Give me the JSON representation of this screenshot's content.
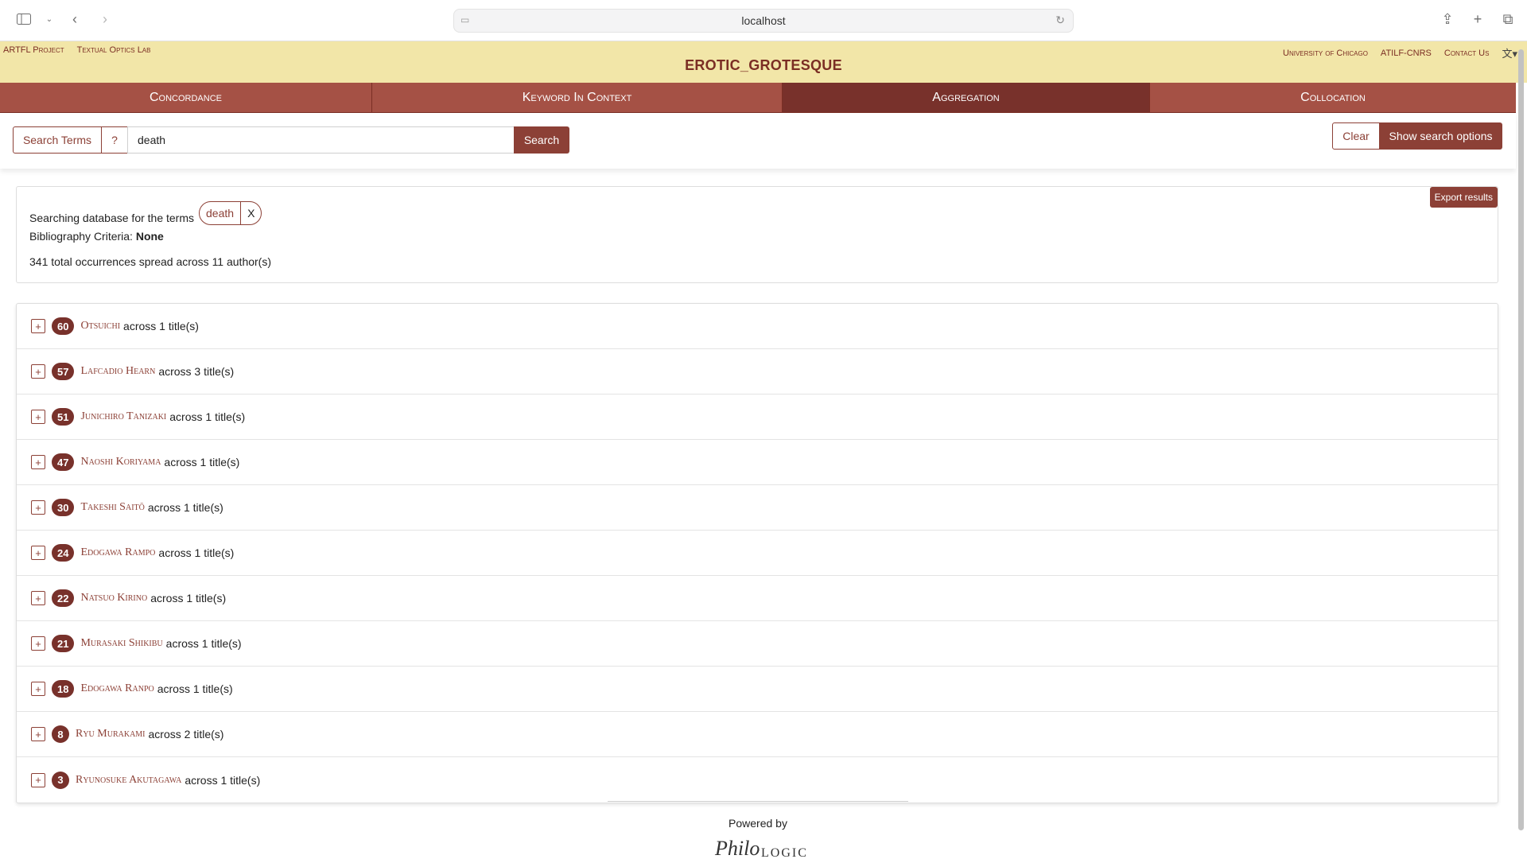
{
  "browser": {
    "url": "localhost"
  },
  "header": {
    "left_links": [
      "ARTFL Project",
      "Textual Optics Lab"
    ],
    "right_links": [
      "University of Chicago",
      "ATILF-CNRS",
      "Contact Us"
    ],
    "title": "EROTIC_GROTESQUE"
  },
  "tabs": [
    {
      "label": "Concordance",
      "active": false
    },
    {
      "label": "Keyword In Context",
      "active": false
    },
    {
      "label": "Aggregation",
      "active": true
    },
    {
      "label": "Collocation",
      "active": false
    }
  ],
  "search": {
    "terms_label": "Search Terms",
    "help_label": "?",
    "value": "death",
    "search_label": "Search",
    "clear_label": "Clear",
    "options_label": "Show search options"
  },
  "summary": {
    "export_label": "Export results",
    "searching_text": "Searching database for the terms",
    "term": "death",
    "term_remove": "X",
    "biblio_label": "Bibliography Criteria:",
    "biblio_value": "None",
    "totals": "341 total occurrences spread across 11 author(s)"
  },
  "results": [
    {
      "count": "60",
      "author": "Otsuichi",
      "titles": "across 1 title(s)"
    },
    {
      "count": "57",
      "author": "Lafcadio Hearn",
      "titles": "across 3 title(s)"
    },
    {
      "count": "51",
      "author": "Junichiro Tanizaki",
      "titles": "across 1 title(s)"
    },
    {
      "count": "47",
      "author": "Naoshi Koriyama",
      "titles": "across 1 title(s)"
    },
    {
      "count": "30",
      "author": "Takeshi Saitō",
      "titles": "across 1 title(s)"
    },
    {
      "count": "24",
      "author": "Edogawa Rampo",
      "titles": "across 1 title(s)"
    },
    {
      "count": "22",
      "author": "Natsuo Kirino",
      "titles": "across 1 title(s)"
    },
    {
      "count": "21",
      "author": "Murasaki Shikibu",
      "titles": "across 1 title(s)"
    },
    {
      "count": "18",
      "author": "Edogawa Ranpo",
      "titles": "across 1 title(s)"
    },
    {
      "count": "8",
      "author": "Ryu Murakami",
      "titles": "across 2 title(s)"
    },
    {
      "count": "3",
      "author": "Ryunosuke Akutagawa",
      "titles": "across 1 title(s)"
    }
  ],
  "footer": {
    "powered_by": "Powered by",
    "logo_text": "PhiloLogic"
  },
  "colors": {
    "header_bg": "#f2e6a8",
    "tab_bg": "#a55145",
    "tab_active_bg": "#78312b",
    "accent": "#8c4036"
  }
}
